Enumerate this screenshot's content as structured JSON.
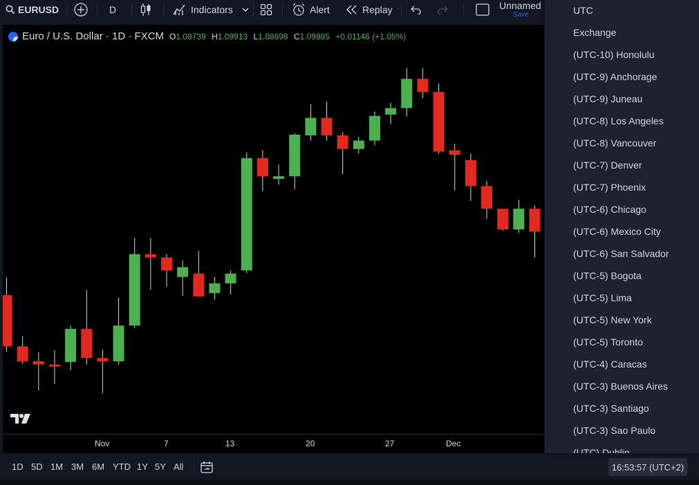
{
  "toolbar": {
    "symbol": "EURUSD",
    "interval": "D",
    "indicators_label": "Indicators",
    "alert_label": "Alert",
    "replay_label": "Replay",
    "layout_name": "Unnamed",
    "save_label": "Save"
  },
  "legend": {
    "title": "Euro / U.S. Dollar · 1D · FXCM",
    "open_label": "O",
    "open": "1.08739",
    "high_label": "H",
    "high": "1.09913",
    "low_label": "L",
    "low": "1.08698",
    "close_label": "C",
    "close": "1.09885",
    "change": "+0.01146 (+1.05%)"
  },
  "x_axis": {
    "labels": [
      "Nov",
      "7",
      "13",
      "20",
      "27",
      "Dec"
    ]
  },
  "colors": {
    "up": "#4caf50",
    "down": "#e0291f",
    "background": "#000000",
    "panel": "#131722",
    "menu": "#1e222d",
    "accent": "#2962ff"
  },
  "chart_data": {
    "type": "candlestick",
    "symbol": "EURUSD",
    "timeframe": "1D",
    "series": [
      {
        "date": "Oct 24",
        "open": 1.0667,
        "high": 1.0694,
        "low": 1.058,
        "close": 1.0588
      },
      {
        "date": "Oct 25",
        "open": 1.0588,
        "high": 1.0604,
        "low": 1.0561,
        "close": 1.0565
      },
      {
        "date": "Oct 26",
        "open": 1.0565,
        "high": 1.0579,
        "low": 1.052,
        "close": 1.056
      },
      {
        "date": "Oct 27",
        "open": 1.056,
        "high": 1.0582,
        "low": 1.053,
        "close": 1.0557
      },
      {
        "date": "Oct 30",
        "open": 1.0564,
        "high": 1.062,
        "low": 1.0551,
        "close": 1.0615
      },
      {
        "date": "Oct 31",
        "open": 1.0615,
        "high": 1.0675,
        "low": 1.056,
        "close": 1.057
      },
      {
        "date": "Nov 1",
        "open": 1.057,
        "high": 1.0583,
        "low": 1.0516,
        "close": 1.0565
      },
      {
        "date": "Nov 2",
        "open": 1.0565,
        "high": 1.0663,
        "low": 1.056,
        "close": 1.062
      },
      {
        "date": "Nov 3",
        "open": 1.062,
        "high": 1.0755,
        "low": 1.0616,
        "close": 1.073
      },
      {
        "date": "Nov 6",
        "open": 1.073,
        "high": 1.0755,
        "low": 1.0675,
        "close": 1.0725
      },
      {
        "date": "Nov 7",
        "open": 1.0725,
        "high": 1.073,
        "low": 1.068,
        "close": 1.0705
      },
      {
        "date": "Nov 8",
        "open": 1.0695,
        "high": 1.072,
        "low": 1.0666,
        "close": 1.071
      },
      {
        "date": "Nov 9",
        "open": 1.07,
        "high": 1.0735,
        "low": 1.0667,
        "close": 1.0665
      },
      {
        "date": "Nov 10",
        "open": 1.067,
        "high": 1.0695,
        "low": 1.066,
        "close": 1.0685
      },
      {
        "date": "Nov 13",
        "open": 1.0685,
        "high": 1.0705,
        "low": 1.0668,
        "close": 1.07
      },
      {
        "date": "Nov 14",
        "open": 1.0705,
        "high": 1.0887,
        "low": 1.0701,
        "close": 1.0878
      },
      {
        "date": "Nov 15",
        "open": 1.0878,
        "high": 1.089,
        "low": 1.0827,
        "close": 1.085
      },
      {
        "date": "Nov 16",
        "open": 1.0846,
        "high": 1.0868,
        "low": 1.0837,
        "close": 1.085
      },
      {
        "date": "Nov 17",
        "open": 1.085,
        "high": 1.0916,
        "low": 1.083,
        "close": 1.0914
      },
      {
        "date": "Nov 20",
        "open": 1.0913,
        "high": 1.0961,
        "low": 1.0905,
        "close": 1.094
      },
      {
        "date": "Nov 21",
        "open": 1.094,
        "high": 1.0965,
        "low": 1.0905,
        "close": 1.0913
      },
      {
        "date": "Nov 22",
        "open": 1.0913,
        "high": 1.0918,
        "low": 1.0853,
        "close": 1.0892
      },
      {
        "date": "Nov 23",
        "open": 1.0892,
        "high": 1.0911,
        "low": 1.0885,
        "close": 1.0905
      },
      {
        "date": "Nov 24",
        "open": 1.0905,
        "high": 1.095,
        "low": 1.0898,
        "close": 1.0943
      },
      {
        "date": "Nov 27",
        "open": 1.0945,
        "high": 1.0963,
        "low": 1.093,
        "close": 1.0955
      },
      {
        "date": "Nov 28",
        "open": 1.0955,
        "high": 1.1017,
        "low": 1.0942,
        "close": 1.1
      },
      {
        "date": "Nov 29",
        "open": 1.1,
        "high": 1.1017,
        "low": 1.097,
        "close": 1.098
      },
      {
        "date": "Nov 30",
        "open": 1.098,
        "high": 1.0993,
        "low": 1.0885,
        "close": 1.0888
      },
      {
        "date": "Dec 1",
        "open": 1.089,
        "high": 1.09,
        "low": 1.0828,
        "close": 1.0883
      },
      {
        "date": "Dec 4",
        "open": 1.0875,
        "high": 1.0885,
        "low": 1.0812,
        "close": 1.0835
      },
      {
        "date": "Dec 5",
        "open": 1.0835,
        "high": 1.0843,
        "low": 1.0784,
        "close": 1.08
      },
      {
        "date": "Dec 6",
        "open": 1.08,
        "high": 1.08,
        "low": 1.0766,
        "close": 1.0768
      },
      {
        "date": "Dec 7",
        "open": 1.0768,
        "high": 1.0814,
        "low": 1.0763,
        "close": 1.08
      },
      {
        "date": "Dec 8",
        "open": 1.08,
        "high": 1.0805,
        "low": 1.0725,
        "close": 1.0765
      }
    ]
  },
  "bottom_bar": {
    "ranges": [
      "1D",
      "5D",
      "1M",
      "3M",
      "6M",
      "YTD",
      "1Y",
      "5Y",
      "All"
    ],
    "clock": "16:53:57 (UTC+2)"
  },
  "timezone_menu": {
    "items": [
      "UTC",
      "Exchange",
      "(UTC-10) Honolulu",
      "(UTC-9) Anchorage",
      "(UTC-9) Juneau",
      "(UTC-8) Los Angeles",
      "(UTC-8) Vancouver",
      "(UTC-7) Denver",
      "(UTC-7) Phoenix",
      "(UTC-6) Chicago",
      "(UTC-6) Mexico City",
      "(UTC-6) San Salvador",
      "(UTC-5) Bogota",
      "(UTC-5) Lima",
      "(UTC-5) New York",
      "(UTC-5) Toronto",
      "(UTC-4) Caracas",
      "(UTC-3) Buenos Aires",
      "(UTC-3) Santiago",
      "(UTC-3) Sao Paulo",
      "(UTC) Dublin"
    ]
  }
}
